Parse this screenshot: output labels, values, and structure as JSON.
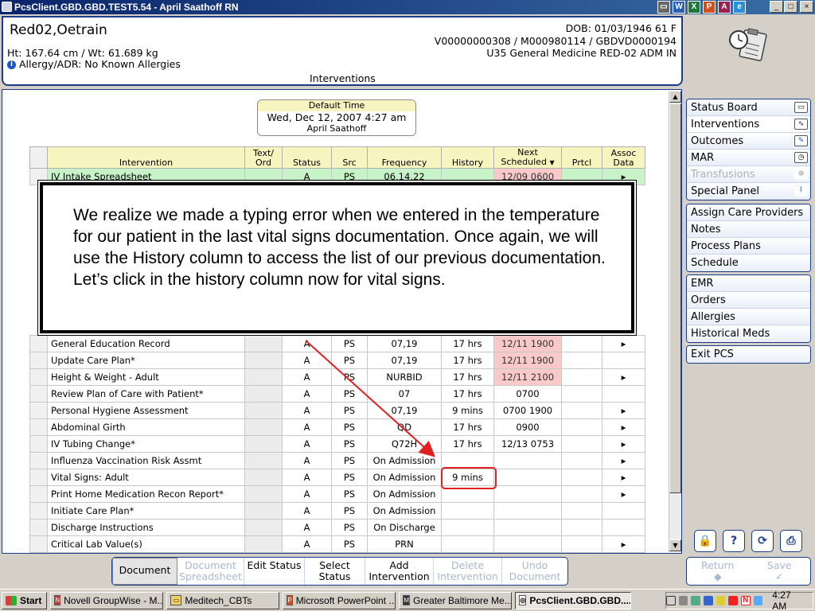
{
  "window": {
    "title": "PcsClient.GBD.GBD.TEST5.54 - April Saathoff RN",
    "title_apps": [
      "W",
      "X",
      "P",
      "A",
      "e"
    ],
    "controls": [
      "_",
      "□",
      "×"
    ]
  },
  "patient": {
    "name": "Red02,Oetrain",
    "dob": "DOB: 01/03/1946 61 F",
    "ids": "V00000000308 / M000980114 / GBDVD0000194",
    "location": "U35 General Medicine  RED-02  ADM IN",
    "ht_wt": "Ht: 167.64 cm / Wt: 61.689 kg",
    "allergy": "Allergy/ADR: No Known Allergies",
    "allergy_icon": "i",
    "screen_title": "Interventions"
  },
  "default_time": {
    "label": "Default Time",
    "datetime": "Wed, Dec 12, 2007  4:27 am",
    "user": "April Saathoff"
  },
  "table": {
    "headers": {
      "intervention": "Intervention",
      "text_ord": "Text/ Ord",
      "status": "Status",
      "src": "Src",
      "frequency": "Frequency",
      "history": "History",
      "next": "Next Scheduled",
      "prtcl": "Prtcl",
      "assoc": "Assoc Data"
    },
    "sort_indicator": "▼",
    "row_first": {
      "intervention": "IV Intake Spreadsheet",
      "status": "A",
      "src": "PS",
      "frequency": "06,14,22",
      "history": "",
      "next": "12/09 0600",
      "assoc": "▸"
    },
    "rows": [
      {
        "intervention": "General Education Record",
        "status": "A",
        "src": "PS",
        "frequency": "07,19",
        "history": "17 hrs",
        "next": "12/11 1900",
        "assoc": "▸"
      },
      {
        "intervention": "Update Care Plan*",
        "status": "A",
        "src": "PS",
        "frequency": "07,19",
        "history": "17 hrs",
        "next": "12/11 1900",
        "assoc": ""
      },
      {
        "intervention": "Height & Weight - Adult",
        "status": "A",
        "src": "PS",
        "frequency": "NURBID",
        "history": "17 hrs",
        "next": "12/11 2100",
        "assoc": "▸"
      },
      {
        "intervention": "Review Plan of Care with Patient*",
        "status": "A",
        "src": "PS",
        "frequency": "07",
        "history": "17 hrs",
        "next": "0700",
        "assoc": ""
      },
      {
        "intervention": "Personal Hygiene Assessment",
        "status": "A",
        "src": "PS",
        "frequency": "07,19",
        "history": "9 mins",
        "next": "0700 1900",
        "assoc": "▸"
      },
      {
        "intervention": "Abdominal Girth",
        "status": "A",
        "src": "PS",
        "frequency": "QD",
        "history": "17 hrs",
        "next": "0900",
        "assoc": "▸"
      },
      {
        "intervention": "IV Tubing Change*",
        "status": "A",
        "src": "PS",
        "frequency": "Q72H",
        "history": "17 hrs",
        "next": "12/13 0753",
        "assoc": "▸"
      },
      {
        "intervention": "Influenza Vaccination Risk Assmt",
        "status": "A",
        "src": "PS",
        "frequency": "On Admission",
        "history": "",
        "next": "",
        "assoc": "▸"
      },
      {
        "intervention": "Vital Signs: Adult",
        "status": "A",
        "src": "PS",
        "frequency": "On Admission",
        "history": "9 mins",
        "next": "",
        "assoc": "▸"
      },
      {
        "intervention": "Print Home Medication Recon Report*",
        "status": "A",
        "src": "PS",
        "frequency": "On Admission",
        "history": "",
        "next": "",
        "assoc": "▸"
      },
      {
        "intervention": "Initiate Care Plan*",
        "status": "A",
        "src": "PS",
        "frequency": "On Admission",
        "history": "",
        "next": "",
        "assoc": ""
      },
      {
        "intervention": "Discharge Instructions",
        "status": "A",
        "src": "PS",
        "frequency": "On Discharge",
        "history": "",
        "next": "",
        "assoc": ""
      },
      {
        "intervention": "Critical Lab Value(s)",
        "status": "A",
        "src": "PS",
        "frequency": "PRN",
        "history": "",
        "next": "",
        "assoc": "▸"
      }
    ]
  },
  "callout": {
    "text": "We realize we made a typing error when we entered in the temperature for our patient in the last vital signs documentation. Once again, we will use the History column to access the list of our previous documentation. Let’s click in the history column now for vital signs."
  },
  "right_nav": {
    "group1": [
      {
        "label": "Status Board",
        "icon": "book-icon",
        "glyph": "▭"
      },
      {
        "label": "Interventions",
        "icon": "stethoscope-icon",
        "glyph": "∿"
      },
      {
        "label": "Outcomes",
        "icon": "pencil-icon",
        "glyph": "✎"
      },
      {
        "label": "MAR",
        "icon": "clock-icon",
        "glyph": "◷"
      },
      {
        "label": "Transfusions",
        "icon": "blood-drop-icon",
        "glyph": "●"
      },
      {
        "label": "Special Panel",
        "icon": "waveform-icon",
        "glyph": "⌇"
      }
    ],
    "group2": [
      "Assign Care Providers",
      "Notes",
      "Process Plans",
      "Schedule"
    ],
    "group3": [
      "EMR",
      "Orders",
      "Allergies",
      "Historical Meds"
    ],
    "group4": [
      "Exit PCS"
    ]
  },
  "tool_buttons": {
    "lock": "🔒",
    "help": "?",
    "refresh": "⟳",
    "print": "⎙"
  },
  "bottom_toolbar": [
    {
      "label": "Document",
      "disabled": false,
      "selected": true
    },
    {
      "label": "Document Spreadsheet",
      "disabled": true
    },
    {
      "label": "Edit Status",
      "disabled": false
    },
    {
      "label": "Select Status",
      "disabled": false
    },
    {
      "label": "Add Intervention",
      "disabled": false
    },
    {
      "label": "Delete Intervention",
      "disabled": true
    },
    {
      "label": "Undo Document",
      "disabled": true
    }
  ],
  "right_actions": {
    "return": "Return",
    "return_glyph": "◆",
    "save": "Save",
    "save_glyph": "✓"
  },
  "taskbar": {
    "start": "Start",
    "items": [
      {
        "label": "Novell GroupWise - M...",
        "icon": "N"
      },
      {
        "label": "Meditech_CBTs",
        "icon": "▭"
      },
      {
        "label": "Microsoft PowerPoint ...",
        "icon": "P"
      },
      {
        "label": "Greater Baltimore Me...",
        "icon": "M"
      },
      {
        "label": "PcsClient.GBD.GBD....",
        "icon": "◎"
      }
    ],
    "clock": "4:27 AM"
  },
  "colors": {
    "brand": "#1b3a8a",
    "overdue": "#f9c8c8",
    "highlight": "#e02020",
    "header_band": "#f7f4c0",
    "green_row": "#c8f3c8"
  }
}
